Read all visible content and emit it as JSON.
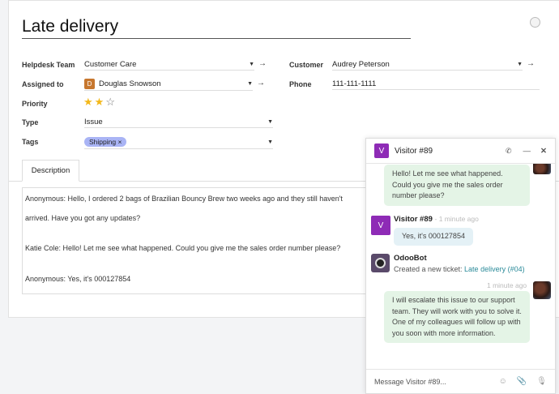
{
  "ticket": {
    "title": "Late delivery"
  },
  "fields": {
    "helpdesk_team": {
      "label": "Helpdesk Team",
      "value": "Customer Care"
    },
    "assigned_to": {
      "label": "Assigned to",
      "value": "Douglas Snowson",
      "initial": "D"
    },
    "priority": {
      "label": "Priority",
      "value": 2,
      "max": 3
    },
    "type": {
      "label": "Type",
      "value": "Issue"
    },
    "tags": {
      "label": "Tags",
      "items": [
        "Shipping ×"
      ]
    },
    "customer": {
      "label": "Customer",
      "value": "Audrey Peterson"
    },
    "phone": {
      "label": "Phone",
      "value": "111-111-1111"
    }
  },
  "tabs": {
    "description": "Description"
  },
  "description": [
    "Anonymous: Hello, I ordered 2 bags of Brazilian Bouncy Brew two weeks ago and they still haven't",
    "arrived. Have you got any updates?",
    "Katie Cole: Hello! Let me see what happened. Could you give me the sales order number please?",
    "Anonymous: Yes, it's 000127854"
  ],
  "chat": {
    "title": "Visitor #89",
    "initial": "V",
    "messages": [
      {
        "text": "Hello! Let me see what happened. Could you give me the sales order number please?"
      },
      {
        "author": "Visitor #89",
        "time": "- 1 minute ago",
        "text": "Yes, it's 000127854"
      },
      {
        "author": "OdooBot",
        "text": "Created a new ticket: ",
        "link": "Late delivery (#04)"
      },
      {
        "time": "1 minute ago",
        "text": "I will escalate this issue to our support team. They will work with you to solve it. One of my colleagues will follow up with you soon with more information."
      }
    ],
    "placeholder": "Message Visitor #89..."
  },
  "colors": {
    "accent": "#8e2bb6",
    "bubble_green": "#e4f4e6",
    "bubble_blue": "#e4f1f6",
    "tag": "#a9b4f5"
  }
}
